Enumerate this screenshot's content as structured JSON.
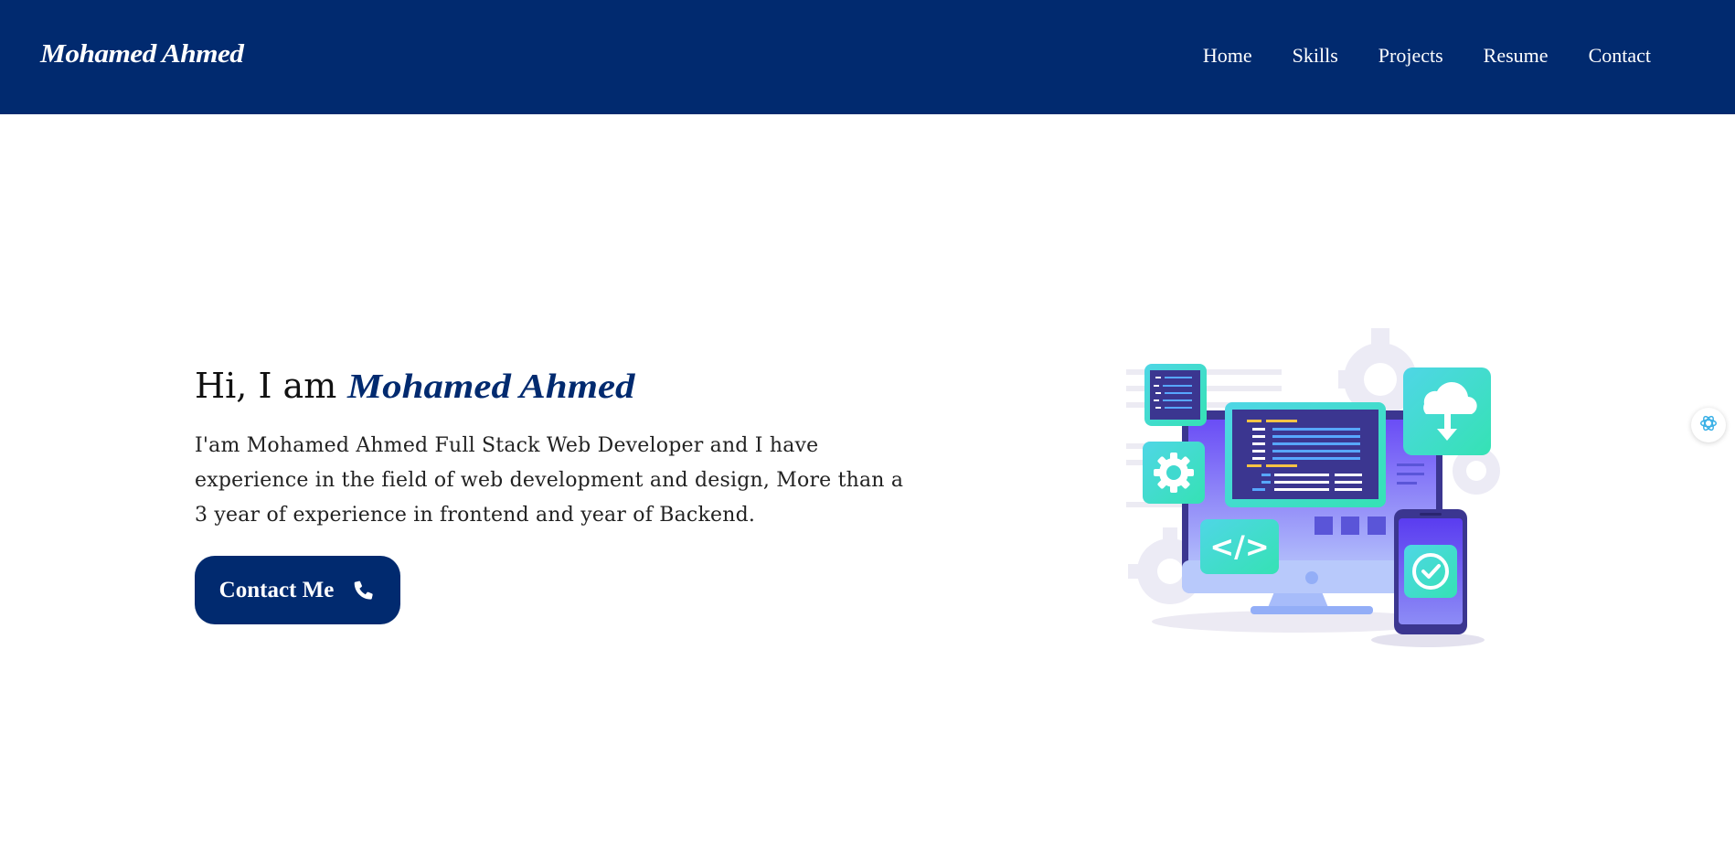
{
  "navbar": {
    "logo": "Mohamed Ahmed",
    "links": [
      {
        "label": "Home"
      },
      {
        "label": "Skills"
      },
      {
        "label": "Projects"
      },
      {
        "label": "Resume"
      },
      {
        "label": "Contact"
      }
    ],
    "background_color": "#012a6f"
  },
  "hero": {
    "greeting_prefix": "Hi, I am",
    "name": "Mohamed Ahmed",
    "bio": "I'am Mohamed Ahmed Full Stack Web Developer and I have experience in the field of web development and design, More than a 3 year of experience in frontend and year of Backend.",
    "cta_label": "Contact Me",
    "cta_icon": "phone-icon",
    "accent_color": "#012a6f"
  },
  "illustration": {
    "icon": "web-development-illustration"
  },
  "side_widget": {
    "icon": "assistant-icon"
  }
}
